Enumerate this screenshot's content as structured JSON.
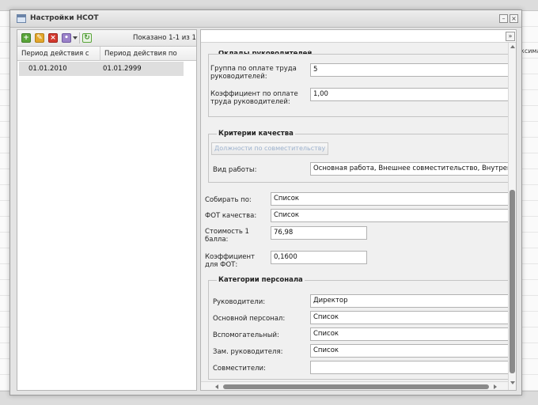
{
  "background": {
    "right_header_fragment": "ксима"
  },
  "window": {
    "title": "Настройки НСОТ",
    "minimize_glyph": "–",
    "close_glyph": "×",
    "icon": "window-icon"
  },
  "left_panel": {
    "toolbar": {
      "add_glyph": "+",
      "edit_glyph": "✎",
      "delete_glyph": "×",
      "more_glyph": "•",
      "refresh_glyph": "↻",
      "paging": "Показано 1-1 из 1"
    },
    "columns": [
      "Период действия с",
      "Период действия по"
    ],
    "rows": [
      {
        "from": "01.01.2010",
        "to": "01.01.2999"
      }
    ]
  },
  "right_panel": {
    "expand_glyph": "»",
    "managers_section": {
      "legend": "Оклады руководителей",
      "group_label": "Группа по оплате труда руководителей:",
      "group_label_l1": "Группа по оплате труда",
      "group_label_l2": "руководителей:",
      "group_value": "5",
      "coef_label_l1": "Коэффициент по оплате",
      "coef_label_l2": "труда руководителей:",
      "coef_value": "1,00"
    },
    "quality_section": {
      "legend": "Критерии качества",
      "button_label": "Должности по совместительству",
      "work_type_label": "Вид работы:",
      "work_type_value": "Основная работа, Внешнее совместительство, Внутреннее совместительство"
    },
    "collect_by_label": "Собирать по:",
    "collect_by_value": "Список",
    "fot_quality_label": "ФОТ качества:",
    "fot_quality_value": "Список",
    "point_cost_label_l1": "Стоимость 1",
    "point_cost_label_l2": "балла:",
    "point_cost_value": "76,98",
    "fot_coef_label_l1": "Коэффициент",
    "fot_coef_label_l2": "для ФОТ:",
    "fot_coef_value": "0,1600",
    "staff_section": {
      "legend": "Категории персонала",
      "managers_label": "Руководители:",
      "managers_value": "Директор",
      "main_label": "Основной персонал:",
      "main_value": "Список",
      "aux_label": "Вспомогательный:",
      "aux_value": "Список",
      "deputy_label": "Зам. руководителя:",
      "deputy_value": "Список",
      "part_time_label": "Совместители:",
      "part_time_value": ""
    }
  }
}
